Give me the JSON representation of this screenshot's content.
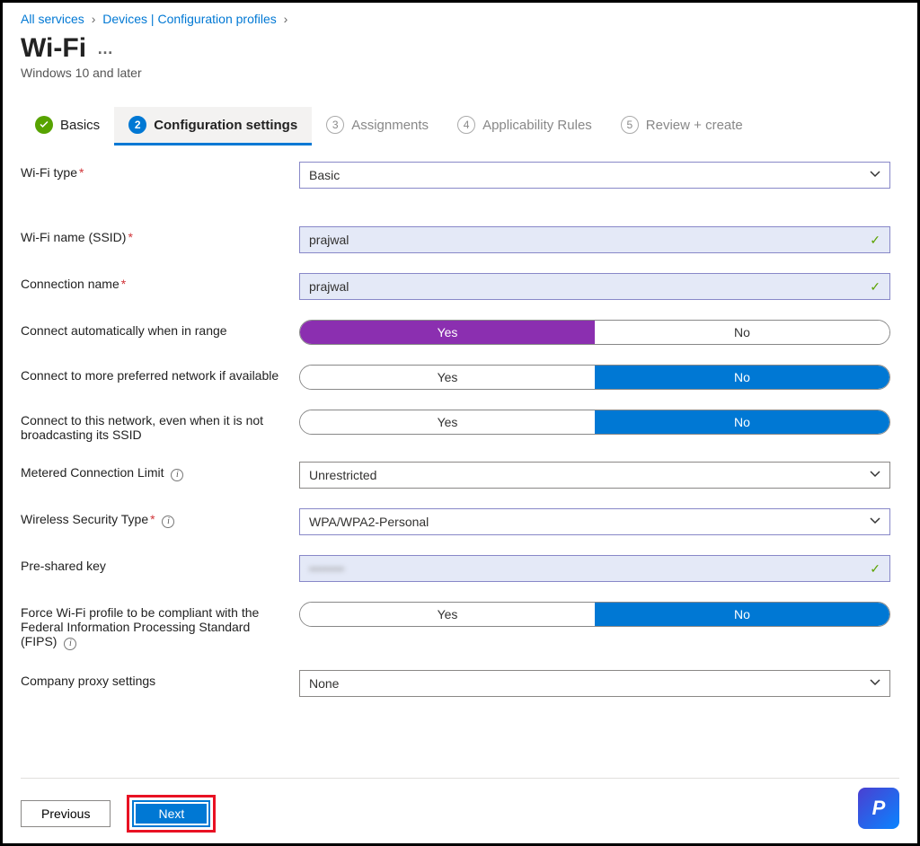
{
  "breadcrumb": {
    "items": [
      "All services",
      "Devices | Configuration profiles"
    ]
  },
  "header": {
    "title": "Wi-Fi",
    "subtitle": "Windows 10 and later"
  },
  "tabs": [
    {
      "label": "Basics",
      "state": "done"
    },
    {
      "num": "2",
      "label": "Configuration settings",
      "state": "active"
    },
    {
      "num": "3",
      "label": "Assignments",
      "state": "pending"
    },
    {
      "num": "4",
      "label": "Applicability Rules",
      "state": "pending"
    },
    {
      "num": "5",
      "label": "Review + create",
      "state": "pending"
    }
  ],
  "form": {
    "wifi_type": {
      "label": "Wi-Fi type",
      "value": "Basic",
      "required": true
    },
    "ssid": {
      "label": "Wi-Fi name (SSID)",
      "value": "prajwal",
      "required": true
    },
    "conn_name": {
      "label": "Connection name",
      "value": "prajwal",
      "required": true
    },
    "auto_connect": {
      "label": "Connect automatically when in range",
      "yes": "Yes",
      "no": "No",
      "value": "Yes"
    },
    "preferred": {
      "label": "Connect to more preferred network if available",
      "yes": "Yes",
      "no": "No",
      "value": "No"
    },
    "hidden": {
      "label": "Connect to this network, even when it is not broadcasting its SSID",
      "yes": "Yes",
      "no": "No",
      "value": "No"
    },
    "metered": {
      "label": "Metered Connection Limit",
      "value": "Unrestricted"
    },
    "security": {
      "label": "Wireless Security Type",
      "value": "WPA/WPA2-Personal",
      "required": true
    },
    "psk": {
      "label": "Pre-shared key",
      "value": "••••••••"
    },
    "fips": {
      "label": "Force Wi-Fi profile to be compliant with the Federal Information Processing Standard (FIPS)",
      "yes": "Yes",
      "no": "No",
      "value": "No"
    },
    "proxy": {
      "label": "Company proxy settings",
      "value": "None"
    }
  },
  "footer": {
    "previous": "Previous",
    "next": "Next"
  },
  "logo_text": "P"
}
